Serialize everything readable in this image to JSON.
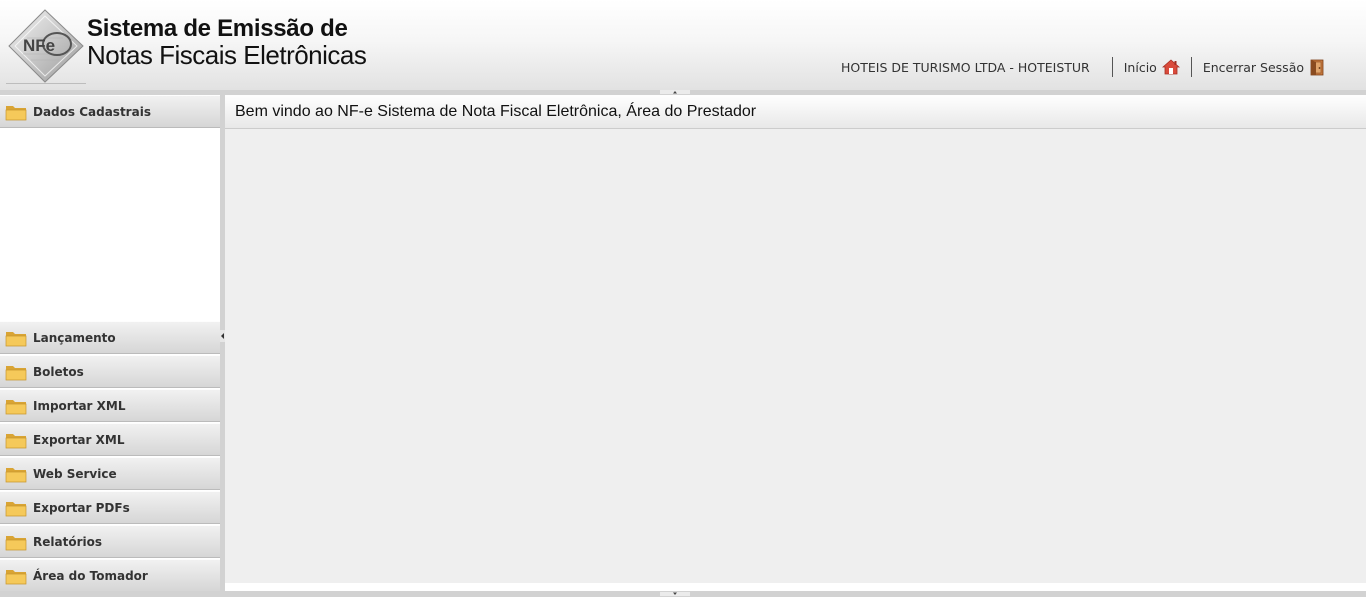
{
  "header": {
    "title_line1": "Sistema de Emissão de",
    "title_line2": "Notas Fiscais Eletrônicas",
    "logo_text": "NFe",
    "company": "HOTEIS DE TURISMO LTDA - HOTEISTUR",
    "nav": {
      "home_label": "Início",
      "home_icon": "house-icon",
      "logout_label": "Encerrar Sessão",
      "logout_icon": "door-exit-icon"
    }
  },
  "sidebar": {
    "active": {
      "label": "Dados Cadastrais",
      "icon": "folder-icon"
    },
    "items": [
      {
        "label": "Lançamento",
        "icon": "folder-icon"
      },
      {
        "label": "Boletos",
        "icon": "folder-icon"
      },
      {
        "label": "Importar XML",
        "icon": "folder-icon"
      },
      {
        "label": "Exportar XML",
        "icon": "folder-icon"
      },
      {
        "label": "Web Service",
        "icon": "folder-icon"
      },
      {
        "label": "Exportar PDFs",
        "icon": "folder-icon"
      },
      {
        "label": "Relatórios",
        "icon": "folder-icon"
      },
      {
        "label": "Área do Tomador",
        "icon": "folder-icon"
      }
    ]
  },
  "main": {
    "title": "Bem vindo ao NF-e Sistema de Nota Fiscal Eletrônica, Área do Prestador"
  },
  "colors": {
    "folder": "#f5c95a",
    "folder_dark": "#d9a434",
    "splitter": "#d2d2d2",
    "content_bg": "#efefef"
  }
}
